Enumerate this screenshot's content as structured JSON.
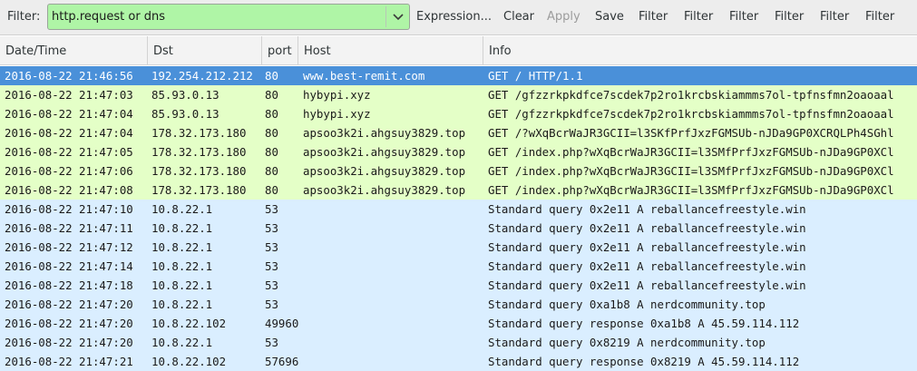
{
  "toolbar": {
    "filter_label": "Filter:",
    "filter_value": "http.request or dns",
    "buttons": [
      "Expression...",
      "Clear",
      "Apply",
      "Save",
      "Filter",
      "Filter",
      "Filter",
      "Filter",
      "Filter",
      "Filter"
    ],
    "filter_bg_color": "#aff5a6"
  },
  "columns": [
    "Date/Time",
    "Dst",
    "port",
    "Host",
    "Info"
  ],
  "colors": {
    "http_row": "#e4ffc7",
    "dns_row": "#daeeff",
    "selected_row": "#4a90d9"
  },
  "packets": [
    {
      "datetime": "2016-08-22 21:46:56",
      "dst": "192.254.212.212",
      "port": "80",
      "host": "www.best-remit.com",
      "info": "GET / HTTP/1.1",
      "type": "http",
      "selected": true
    },
    {
      "datetime": "2016-08-22 21:47:03",
      "dst": "85.93.0.13",
      "port": "80",
      "host": "hybypi.xyz",
      "info": "GET /gfzzrkpkdfce7scdek7p2ro1krcbskiammms7ol-tpfnsfmn2oaoaal",
      "type": "http"
    },
    {
      "datetime": "2016-08-22 21:47:04",
      "dst": "85.93.0.13",
      "port": "80",
      "host": "hybypi.xyz",
      "info": "GET /gfzzrkpkdfce7scdek7p2ro1krcbskiammms7ol-tpfnsfmn2oaoaal",
      "type": "http"
    },
    {
      "datetime": "2016-08-22 21:47:04",
      "dst": "178.32.173.180",
      "port": "80",
      "host": "apsoo3k2i.ahgsuy3829.top",
      "info": "GET /?wXqBcrWaJR3GCII=l3SKfPrfJxzFGMSUb-nJDa9GP0XCRQLPh4SGhl",
      "type": "http"
    },
    {
      "datetime": "2016-08-22 21:47:05",
      "dst": "178.32.173.180",
      "port": "80",
      "host": "apsoo3k2i.ahgsuy3829.top",
      "info": "GET /index.php?wXqBcrWaJR3GCII=l3SMfPrfJxzFGMSUb-nJDa9GP0XCl",
      "type": "http"
    },
    {
      "datetime": "2016-08-22 21:47:06",
      "dst": "178.32.173.180",
      "port": "80",
      "host": "apsoo3k2i.ahgsuy3829.top",
      "info": "GET /index.php?wXqBcrWaJR3GCII=l3SMfPrfJxzFGMSUb-nJDa9GP0XCl",
      "type": "http"
    },
    {
      "datetime": "2016-08-22 21:47:08",
      "dst": "178.32.173.180",
      "port": "80",
      "host": "apsoo3k2i.ahgsuy3829.top",
      "info": "GET /index.php?wXqBcrWaJR3GCII=l3SMfPrfJxzFGMSUb-nJDa9GP0XCl",
      "type": "http"
    },
    {
      "datetime": "2016-08-22 21:47:10",
      "dst": "10.8.22.1",
      "port": "53",
      "host": "",
      "info": "Standard query 0x2e11  A reballancefreestyle.win",
      "type": "dns"
    },
    {
      "datetime": "2016-08-22 21:47:11",
      "dst": "10.8.22.1",
      "port": "53",
      "host": "",
      "info": "Standard query 0x2e11  A reballancefreestyle.win",
      "type": "dns"
    },
    {
      "datetime": "2016-08-22 21:47:12",
      "dst": "10.8.22.1",
      "port": "53",
      "host": "",
      "info": "Standard query 0x2e11  A reballancefreestyle.win",
      "type": "dns"
    },
    {
      "datetime": "2016-08-22 21:47:14",
      "dst": "10.8.22.1",
      "port": "53",
      "host": "",
      "info": "Standard query 0x2e11  A reballancefreestyle.win",
      "type": "dns"
    },
    {
      "datetime": "2016-08-22 21:47:18",
      "dst": "10.8.22.1",
      "port": "53",
      "host": "",
      "info": "Standard query 0x2e11  A reballancefreestyle.win",
      "type": "dns"
    },
    {
      "datetime": "2016-08-22 21:47:20",
      "dst": "10.8.22.1",
      "port": "53",
      "host": "",
      "info": "Standard query 0xa1b8  A nerdcommunity.top",
      "type": "dns"
    },
    {
      "datetime": "2016-08-22 21:47:20",
      "dst": "10.8.22.102",
      "port": "49960",
      "host": "",
      "info": "Standard query response 0xa1b8  A 45.59.114.112",
      "type": "dns"
    },
    {
      "datetime": "2016-08-22 21:47:20",
      "dst": "10.8.22.1",
      "port": "53",
      "host": "",
      "info": "Standard query 0x8219  A nerdcommunity.top",
      "type": "dns"
    },
    {
      "datetime": "2016-08-22 21:47:21",
      "dst": "10.8.22.102",
      "port": "57696",
      "host": "",
      "info": "Standard query response 0x8219  A 45.59.114.112",
      "type": "dns"
    }
  ]
}
